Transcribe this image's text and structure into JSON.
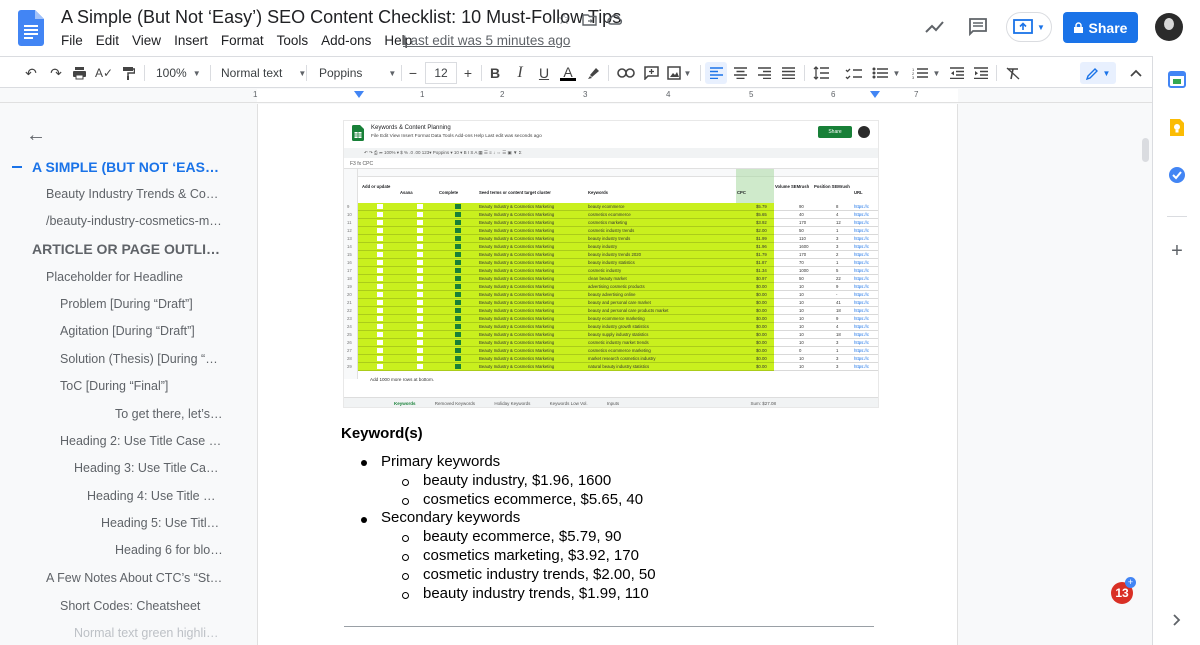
{
  "doc": {
    "title": "A Simple (But Not ‘Easy’) SEO Content Checklist: 10 Must-Follow Tips",
    "menu": [
      "File",
      "Edit",
      "View",
      "Insert",
      "Format",
      "Tools",
      "Add-ons",
      "Help"
    ],
    "last_edit": "Last edit was 5 minutes ago",
    "share_label": "Share"
  },
  "toolbar": {
    "zoom": "100%",
    "style": "Normal text",
    "font": "Poppins",
    "font_size": "12",
    "minus": "−",
    "plus": "+"
  },
  "ruler": {
    "numbers": [
      "1",
      "1",
      "2",
      "3",
      "4",
      "5",
      "6",
      "7"
    ]
  },
  "outline": {
    "items": [
      {
        "label": "A SIMPLE (BUT NOT ‘EASY’) ...",
        "level": 0,
        "heading": true,
        "active": true
      },
      {
        "label": "Beauty Industry Trends & Cosm...",
        "level": 1
      },
      {
        "label": "/beauty-industry-cosmetics-mar...",
        "level": 1
      },
      {
        "label": "ARTICLE OR PAGE OUTLINE: ...",
        "level": 0,
        "heading": true
      },
      {
        "label": "Placeholder for Headline",
        "level": 1
      },
      {
        "label": "Problem [During “Draft”]",
        "level": 2
      },
      {
        "label": "Agitation [During “Draft”]",
        "level": 2
      },
      {
        "label": "Solution (Thesis) [During “Ou...",
        "level": 2
      },
      {
        "label": "ToC [During “Final”]",
        "level": 2
      },
      {
        "label": "To get there, let’s e...",
        "level": 6
      },
      {
        "label": "Heading 2: Use Title Case & ...",
        "level": 2
      },
      {
        "label": "Heading 3: Use Title Case ...",
        "level": 3
      },
      {
        "label": "Heading 4: Use Title Cas...",
        "level": 4
      },
      {
        "label": "Heading 5: Use Title ...",
        "level": 5
      },
      {
        "label": "Heading 6 for bloc...",
        "level": 6
      },
      {
        "label": "A Few Notes About CTC’s “Style...",
        "level": 1
      },
      {
        "label": "Short Codes: Cheatsheet",
        "level": 2
      },
      {
        "label": "Normal text green highligh...",
        "level": 3,
        "faded": true
      }
    ]
  },
  "sheet": {
    "title": "Keywords & Content Planning",
    "menu": "File   Edit   View   Insert   Format   Data   Tools   Add-ons   Help     Last edit was seconds ago",
    "share": "Share",
    "toolbar": "↶  ↷  ⎙  ⤗   100%  ▾   $   %   .0   .00   123▾   Poppins   ▾   10   ▾   B   I   S   A   ▦   ☰   ≡   ↓   ⇔   ☰   ▣   ▼   Σ",
    "fx": "F3      fx   CPC",
    "headers": [
      {
        "label": "Add or\nupdate"
      },
      {
        "label": "Asana"
      },
      {
        "label": "Complete"
      },
      {
        "label": "Seed terms or content target cluster"
      },
      {
        "label": "Keywords"
      },
      {
        "label": "CPC"
      },
      {
        "label": "Volume\nSEMrush"
      },
      {
        "label": "Position\nSEMrush"
      },
      {
        "label": "URL"
      }
    ],
    "row_numbers": "9\n10\n11\n12\n13\n14\n15\n16\n17\n18\n19\n20\n21\n22\n23\n24\n25\n26\n27\n28\n29",
    "seed_col": "Beauty Industry & Cosmetics Marketing\nBeauty Industry & Cosmetics Marketing\nBeauty Industry & Cosmetics Marketing\nBeauty Industry & Cosmetics Marketing\nBeauty Industry & Cosmetics Marketing\nBeauty Industry & Cosmetics Marketing\nBeauty Industry & Cosmetics Marketing\nBeauty Industry & Cosmetics Marketing\nBeauty Industry & Cosmetics Marketing\nBeauty Industry & Cosmetics Marketing\nBeauty Industry & Cosmetics Marketing\nBeauty Industry & Cosmetics Marketing\nBeauty Industry & Cosmetics Marketing\nBeauty Industry & Cosmetics Marketing\nBeauty Industry & Cosmetics Marketing\nBeauty Industry & Cosmetics Marketing\nBeauty Industry & Cosmetics Marketing\nBeauty Industry & Cosmetics Marketing\nBeauty Industry & Cosmetics Marketing\nBeauty Industry & Cosmetics Marketing\nBeauty Industry & Cosmetics Marketing",
    "keyword_col": "beauty ecommerce\ncosmetics ecommerce\ncosmetics marketing\ncosmetic industry trends\nbeauty industry trends\nbeauty industry\nbeauty industry trends 2020\nbeauty industry statistics\ncosmetic industry\nclean beauty market\nadvertising cosmetic products\nbeauty advertising online\nbeauty and personal care market\nbeauty and personal care products market\nbeauty ecommerce marketing\nbeauty industry growth statistics\nbeauty supply industry statistics\ncosmetic industry market trends\ncosmetics ecommerce marketing\nmarket research cosmetics industry\nnatural beauty industry statistics",
    "cpc_col": "$5.79\n$5.65\n$3.92\n$2.00\n$1.99\n$1.96\n$1.79\n$1.87\n$1.34\n$0.97\n$0.00\n$0.00\n$0.00\n$0.00\n$0.00\n$0.00\n$0.00\n$0.00\n$0.00\n$0.00\n$0.00",
    "volume_col": "90\n40\n170\n50\n110\n1600\n170\n70\n1000\n50\n10\n10\n10\n10\n10\n10\n10\n10\n0\n10\n10",
    "position_col": "8\n4\n12\n1\n3\n3\n2\n1\n5\n22\n9\n-\n41\n18\n9\n4\n18\n3\n1\n3\n3",
    "url_col": "https://c\nhttps://c\nhttps://c\nhttps://c\nhttps://c\nhttps://c\nhttps://c\nhttps://c\nhttps://c\nhttps://c\nhttps://c\nhttps://c\nhttps://c\nhttps://c\nhttps://c\nhttps://c\nhttps://c\nhttps://c\nhttps://c\nhttps://c\nhttps://c",
    "add_rows": "Add      1000      more rows at bottom.",
    "tabs": [
      "Keywords",
      "Removed Keywords",
      "Holiday Keywords",
      "Keywords Low Vol.",
      "Inputs"
    ],
    "sum": "Sum: $27.08"
  },
  "content": {
    "keyword_heading": "Keyword(s)",
    "primary_label": "Primary keywords",
    "primary": [
      "beauty industry, $1.96, 1600",
      "cosmetics ecommerce, $5.65, 40"
    ],
    "secondary_label": "Secondary keywords",
    "secondary": [
      "beauty ecommerce, $5.79, 90",
      "cosmetics marketing, $3.92, 170",
      "cosmetic industry trends, $2.00, 50",
      "beauty industry trends, $1.99, 110"
    ]
  },
  "notifications": {
    "count": "13",
    "plus": "+"
  },
  "colors": {
    "accent": "#1a73e8",
    "sheet_highlight": "#c9f01e",
    "sheets_green": "#188038"
  },
  "icons": [
    "docs-icon",
    "star-icon",
    "move-folder-icon",
    "cloud-icon",
    "activity-icon",
    "comment-icon",
    "present-icon",
    "lock-icon",
    "undo-icon",
    "redo-icon",
    "print-icon",
    "spellcheck-icon",
    "paint-format-icon",
    "bold-icon",
    "italic-icon",
    "underline-icon",
    "text-color-icon",
    "highlight-icon",
    "link-icon",
    "add-comment-icon",
    "image-icon",
    "align-left-icon",
    "align-center-icon",
    "align-right-icon",
    "justify-icon",
    "line-spacing-icon",
    "checklist-icon",
    "bullet-list-icon",
    "numbered-list-icon",
    "decrease-indent-icon",
    "increase-indent-icon",
    "clear-format-icon",
    "edit-mode-icon",
    "collapse-icon",
    "back-arrow-icon",
    "calendar-icon",
    "keep-icon",
    "tasks-icon",
    "add-icon",
    "expand-panel-icon"
  ]
}
